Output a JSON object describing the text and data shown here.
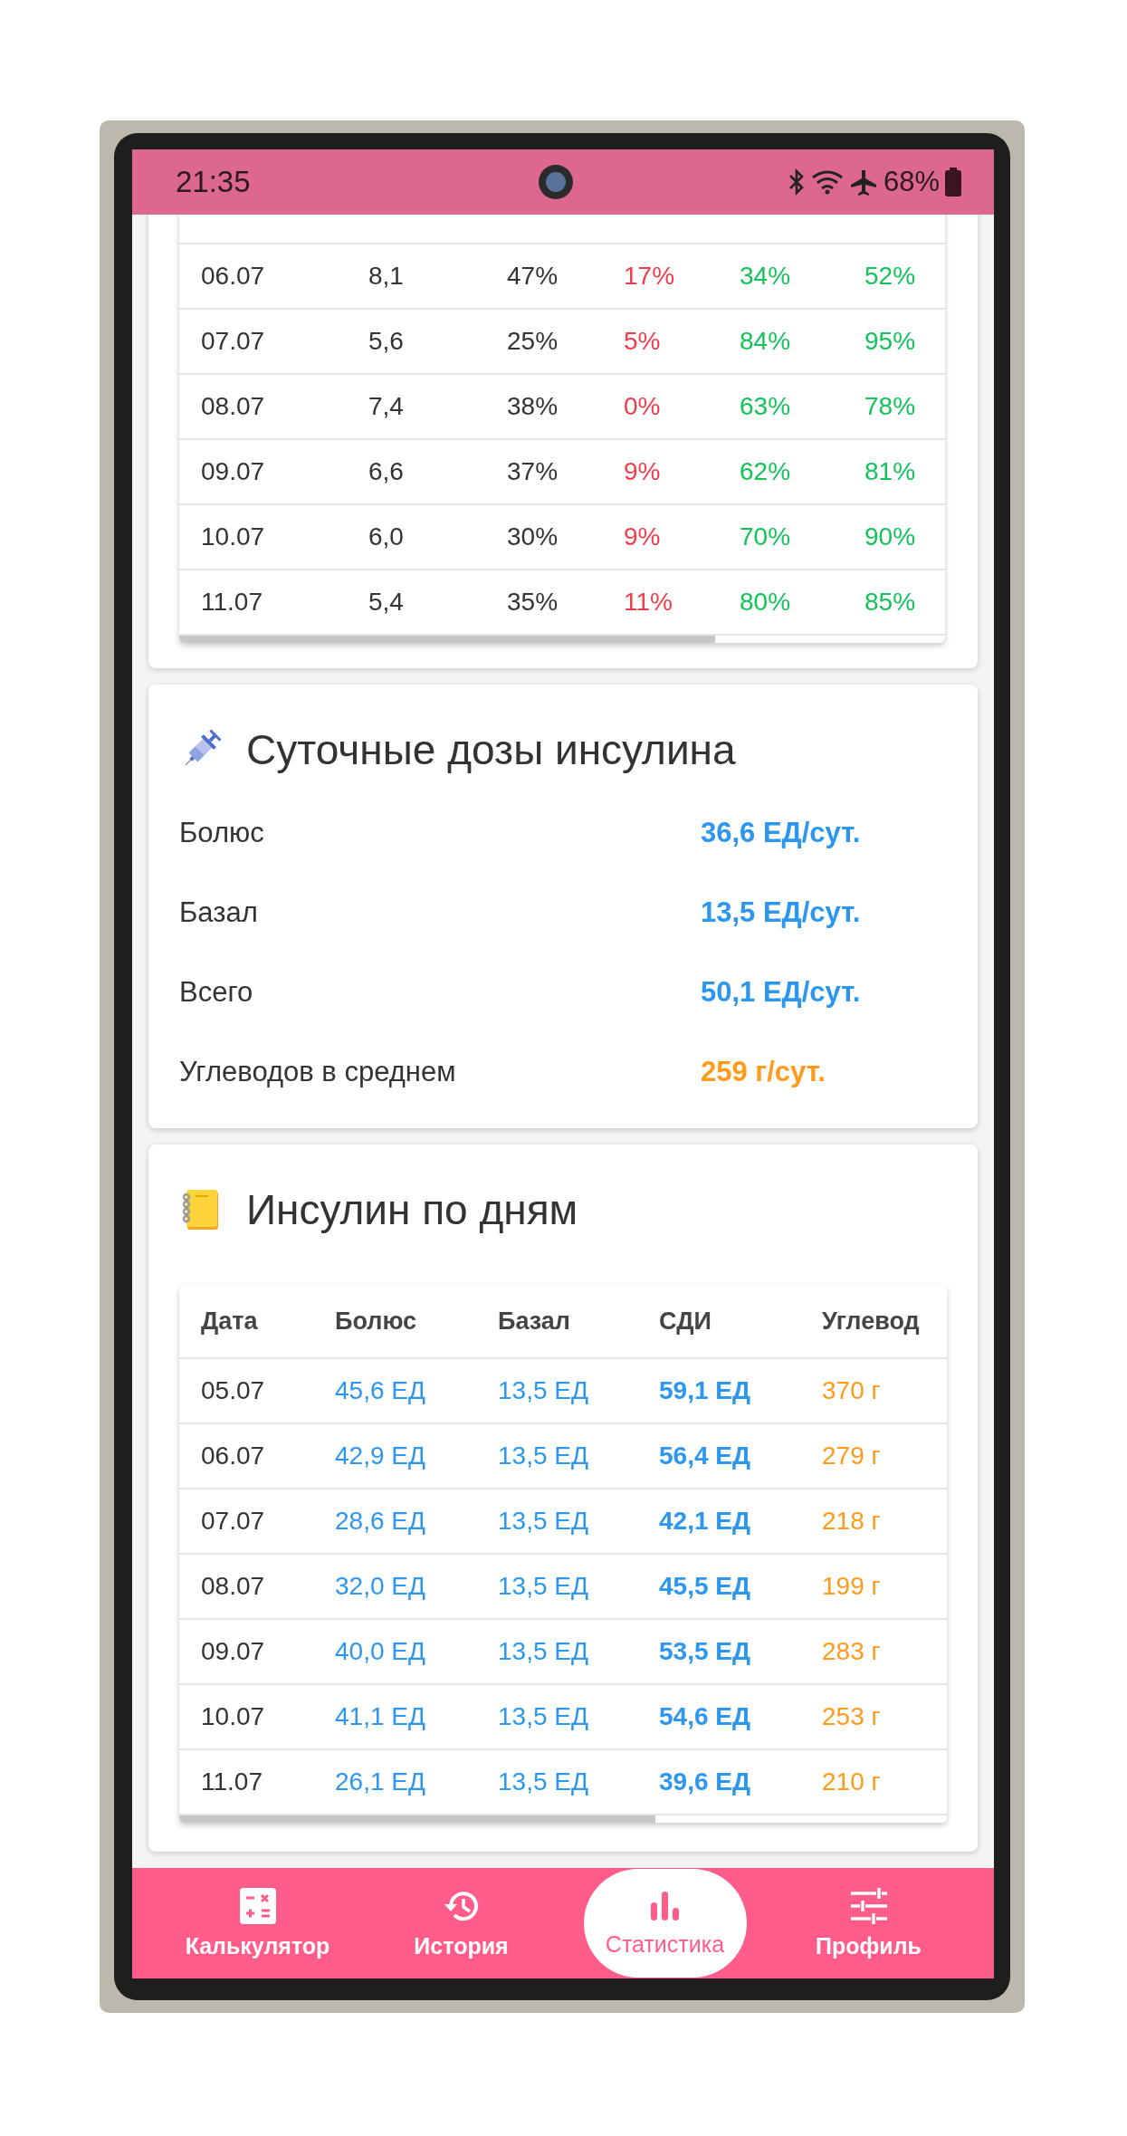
{
  "status_bar": {
    "time": "21:35",
    "battery": "68%"
  },
  "glucose_table": {
    "columns": [
      {
        "kind": "plain"
      },
      {
        "kind": "plain"
      },
      {
        "kind": "plain"
      },
      {
        "kind": "low"
      },
      {
        "kind": "good"
      },
      {
        "kind": "good"
      }
    ],
    "rows": [
      [
        "06.07",
        "8,1",
        "47%",
        "17%",
        "34%",
        "52%"
      ],
      [
        "07.07",
        "5,6",
        "25%",
        "5%",
        "84%",
        "95%"
      ],
      [
        "08.07",
        "7,4",
        "38%",
        "0%",
        "63%",
        "78%"
      ],
      [
        "09.07",
        "6,6",
        "37%",
        "9%",
        "62%",
        "81%"
      ],
      [
        "10.07",
        "6,0",
        "30%",
        "9%",
        "70%",
        "90%"
      ],
      [
        "11.07",
        "5,4",
        "35%",
        "11%",
        "80%",
        "85%"
      ]
    ]
  },
  "daily_doses": {
    "title": "Суточные дозы инсулина",
    "items": [
      {
        "label": "Болюс",
        "value": "36,6 ЕД/сут.",
        "kind": "insulin"
      },
      {
        "label": "Базал",
        "value": "13,5 ЕД/сут.",
        "kind": "insulin"
      },
      {
        "label": "Всего",
        "value": "50,1 ЕД/сут.",
        "kind": "insulin"
      },
      {
        "label": "Углеводов в среднем",
        "value": "259 г/сут.",
        "kind": "carbs"
      }
    ]
  },
  "insulin_by_day": {
    "title": "Инсулин по дням",
    "columns": [
      {
        "label": "Дата",
        "kind": "plain"
      },
      {
        "label": "Болюс",
        "kind": "insulin"
      },
      {
        "label": "Базал",
        "kind": "insulin"
      },
      {
        "label": "СДИ",
        "kind": "total"
      },
      {
        "label": "Углевод",
        "kind": "carbs"
      }
    ],
    "rows": [
      [
        "05.07",
        "45,6 ЕД",
        "13,5 ЕД",
        "59,1 ЕД",
        "370 г"
      ],
      [
        "06.07",
        "42,9 ЕД",
        "13,5 ЕД",
        "56,4 ЕД",
        "279 г"
      ],
      [
        "07.07",
        "28,6 ЕД",
        "13,5 ЕД",
        "42,1 ЕД",
        "218 г"
      ],
      [
        "08.07",
        "32,0 ЕД",
        "13,5 ЕД",
        "45,5 ЕД",
        "199 г"
      ],
      [
        "09.07",
        "40,0 ЕД",
        "13,5 ЕД",
        "53,5 ЕД",
        "283 г"
      ],
      [
        "10.07",
        "41,1 ЕД",
        "13,5 ЕД",
        "54,6 ЕД",
        "253 г"
      ],
      [
        "11.07",
        "26,1 ЕД",
        "13,5 ЕД",
        "39,6 ЕД",
        "210 г"
      ]
    ]
  },
  "bottom_nav": [
    {
      "label": "Калькулятор",
      "selected": false
    },
    {
      "label": "История",
      "selected": false
    },
    {
      "label": "Статистика",
      "selected": true
    },
    {
      "label": "Профиль",
      "selected": false
    }
  ]
}
